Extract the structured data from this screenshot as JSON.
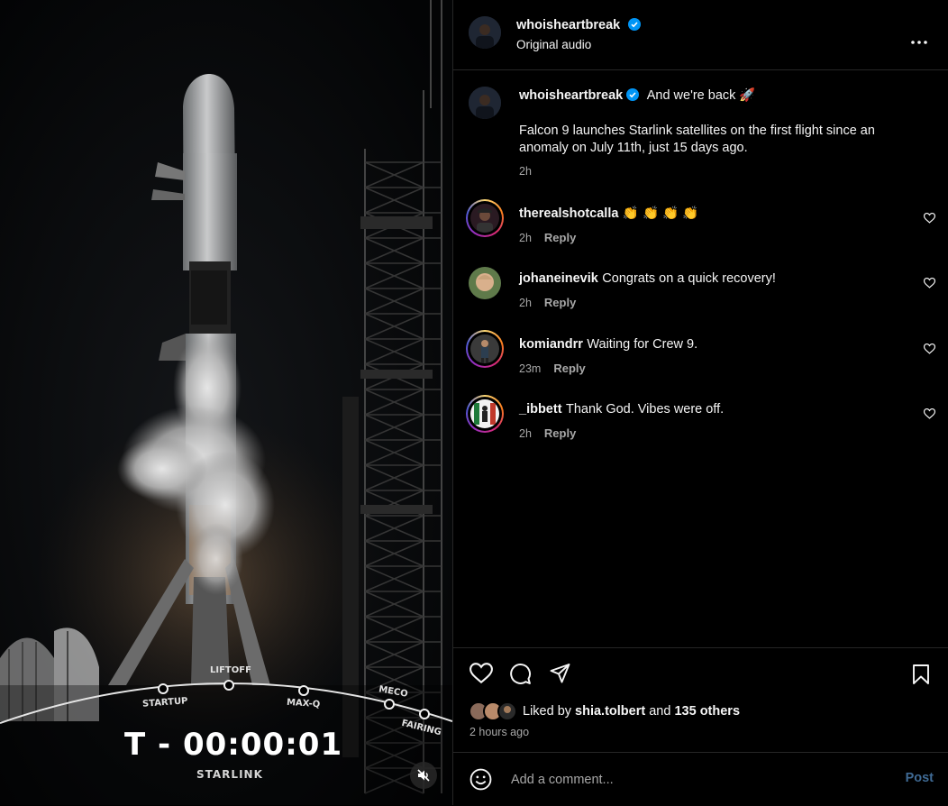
{
  "media": {
    "countdown": "T - 00:00:01",
    "mission": "STARLINK",
    "stages": [
      "STARTUP",
      "LIFTOFF",
      "MAX-Q",
      "MECO",
      "FAIRING"
    ],
    "mute_icon": "speaker-muted-icon"
  },
  "header": {
    "username": "whoisheartbreak",
    "subtitle": "Original audio",
    "more_icon": "more-options-icon"
  },
  "caption": {
    "username": "whoisheartbreak",
    "headline": "And we're back 🚀",
    "body_line1": "Falcon 9 launches Starlink satellites on the first flight since an",
    "body_line2": "anomaly on July 11th, just 15 days ago.",
    "time": "2h"
  },
  "comments": [
    {
      "username": "therealshotcalla",
      "text": "👏 👏 👏 👏",
      "time": "2h",
      "reply": "Reply"
    },
    {
      "username": "johaneinevik",
      "text": "Congrats on a quick recovery!",
      "time": "2h",
      "reply": "Reply"
    },
    {
      "username": "komiandrr",
      "text": "Waiting for Crew 9.",
      "time": "23m",
      "reply": "Reply"
    },
    {
      "username": "_ibbett",
      "text": "Thank God. Vibes were off.",
      "time": "2h",
      "reply": "Reply"
    }
  ],
  "likes": {
    "prefix": "Liked by",
    "user": "shia.tolbert",
    "joiner": "and",
    "others": "135 others",
    "time": "2 hours ago"
  },
  "add_comment": {
    "placeholder": "Add a comment...",
    "post_label": "Post"
  },
  "colors": {
    "background": "#000000",
    "divider": "#262626",
    "secondary_text": "#a8a8a8",
    "verified": "#0095f6",
    "post_button": "#3f6a94"
  }
}
